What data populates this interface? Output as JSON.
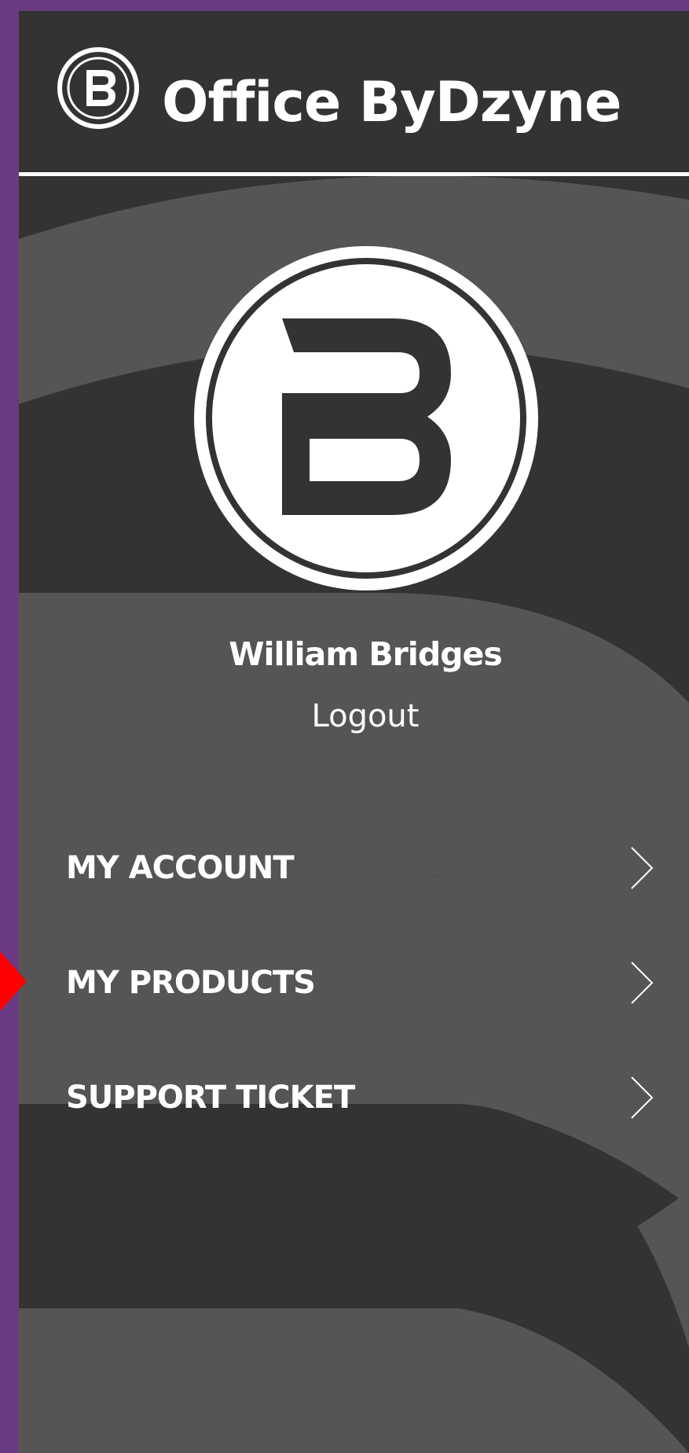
{
  "app": {
    "title": "Office ByDzyne"
  },
  "user": {
    "name": "William Bridges",
    "logout_label": "Logout"
  },
  "menu": {
    "items": [
      {
        "label": "MY ACCOUNT",
        "icon": "chevron-right-icon"
      },
      {
        "label": "MY PRODUCTS",
        "icon": "chevron-right-icon"
      },
      {
        "label": "SUPPORT TICKET",
        "icon": "chevron-right-icon"
      }
    ]
  },
  "colors": {
    "background": "#6a3a82",
    "panel": "#333333",
    "panel_light": "#555555",
    "text": "#ffffff",
    "pointer": "#ff0000"
  }
}
